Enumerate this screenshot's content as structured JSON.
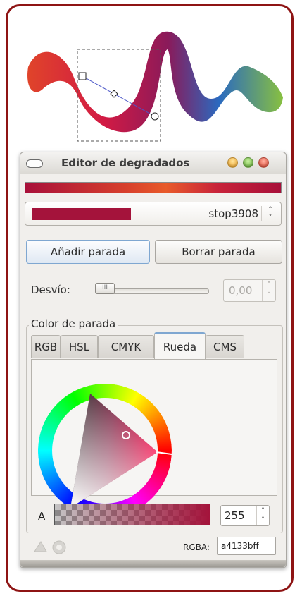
{
  "dialog": {
    "title": "Editor de degradados",
    "stop": {
      "name": "stop3908",
      "color": "#a4133b"
    },
    "add_stop_label": "Añadir parada",
    "delete_stop_label": "Borrar parada",
    "offset_label": "Desvío:",
    "offset_value": "0,00",
    "stop_color_group_label": "Color de parada",
    "tabs": [
      {
        "label": "RGB",
        "active": false
      },
      {
        "label": "HSL",
        "active": false
      },
      {
        "label": "CMYK",
        "active": false
      },
      {
        "label": "Rueda",
        "active": true
      },
      {
        "label": "CMS",
        "active": false
      }
    ],
    "alpha_label": "A",
    "alpha_value": "255",
    "rgba_label": "RGBA:",
    "rgba_value": "a4133bff"
  },
  "colors": {
    "frame_border": "#8e1414",
    "stop_color": "#a4133b",
    "focus_blue": "#7fa7d1"
  }
}
